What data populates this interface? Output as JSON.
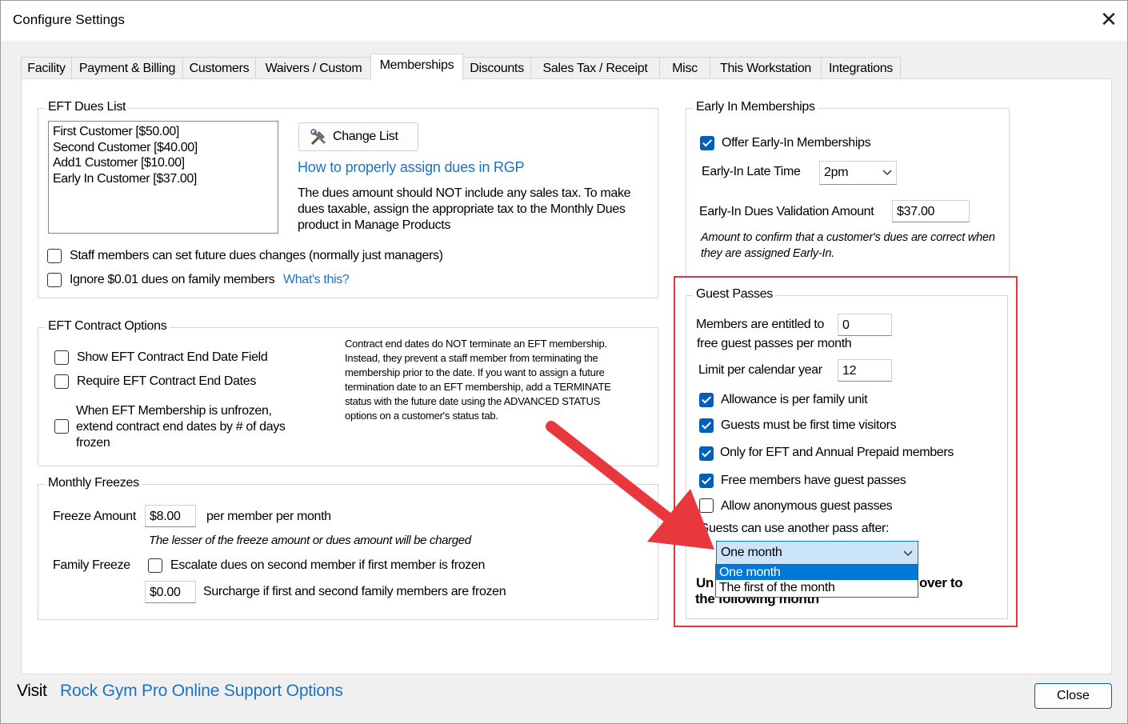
{
  "window": {
    "title": "Configure Settings"
  },
  "tabs": [
    {
      "label": "Facility"
    },
    {
      "label": "Payment & Billing"
    },
    {
      "label": "Customers"
    },
    {
      "label": "Waivers / Custom"
    },
    {
      "label": "Memberships"
    },
    {
      "label": "Discounts"
    },
    {
      "label": "Sales Tax / Receipt"
    },
    {
      "label": "Misc"
    },
    {
      "label": "This Workstation"
    },
    {
      "label": "Integrations"
    }
  ],
  "active_tab": "Memberships",
  "eft_dues": {
    "title": "EFT Dues List",
    "items": [
      "First Customer [$50.00]",
      "Second Customer [$40.00]",
      "Add1 Customer [$10.00]",
      "Early In Customer [$37.00]"
    ],
    "change_list_label": "Change List",
    "help_link": "How to properly assign dues in RGP",
    "note": "The dues amount should NOT include any sales tax. To make dues taxable, assign the appropriate tax to the Monthly Dues product in Manage Products",
    "staff_future_label": "Staff members can set future dues changes (normally just managers)",
    "staff_future_checked": false,
    "ignore_label": "Ignore $0.01 dues on family members",
    "ignore_checked": false,
    "whats_this": "What's this?"
  },
  "contract": {
    "title": "EFT Contract Options",
    "show_end_date_label": "Show EFT Contract End Date Field",
    "require_end_dates_label": "Require EFT Contract End Dates",
    "extend_label": "When EFT Membership is unfrozen, extend contract end dates by # of days frozen",
    "note": "Contract end dates do NOT terminate an EFT membership.  Instead, they prevent a staff member from terminating the membership prior to the date. If you want to assign a future termination date to an EFT membership, add a TERMINATE status with the future date using the ADVANCED STATUS options on a customer's status tab."
  },
  "freezes": {
    "title": "Monthly Freezes",
    "freeze_amount_label": "Freeze Amount",
    "freeze_amount": "$8.00",
    "per_member_label": "per member per month",
    "lesser_note": "The lesser of the freeze amount or dues amount will be charged",
    "family_freeze_label": "Family Freeze",
    "escalate_label": "Escalate dues on second member if first member is frozen",
    "surcharge_amount": "$0.00",
    "surcharge_label": "Surcharge if first and second family members are frozen"
  },
  "early_in": {
    "title": "Early In Memberships",
    "offer_label": "Offer Early-In Memberships",
    "offer_checked": true,
    "late_time_label": "Early-In Late Time",
    "late_time": "2pm",
    "validation_label": "Early-In Dues Validation Amount",
    "validation_amount": "$37.00",
    "validation_note": "Amount to confirm that a customer's dues are correct when they are assigned Early-In."
  },
  "guest": {
    "title": "Guest Passes",
    "entitled_label_1": "Members are entitled to",
    "entitled_value": "0",
    "entitled_label_2": "free guest passes per month",
    "limit_label": "Limit per calendar year",
    "limit_value": "12",
    "allowance_label": "Allowance is per family unit",
    "first_time_label": "Guests must be first time visitors",
    "eft_only_label": "Only for EFT and Annual Prepaid members",
    "free_members_label": "Free members have guest passes",
    "anonymous_label": "Allow anonymous guest passes",
    "another_pass_label": "Guests can use another pass after:",
    "another_pass_value": "One month",
    "options": [
      "One month",
      "The first of the month"
    ],
    "hidden_text_left": "Un",
    "hidden_text_right": "over to",
    "hidden_text_line2": "the following month"
  },
  "footer": {
    "visit_label": "Visit",
    "support_link": "Rock Gym Pro Online Support Options",
    "close_label": "Close"
  },
  "colors": {
    "accent": "#005fb8",
    "link": "#1a73c8",
    "highlight_box": "#e0393e",
    "arrow": "#e8383d"
  }
}
